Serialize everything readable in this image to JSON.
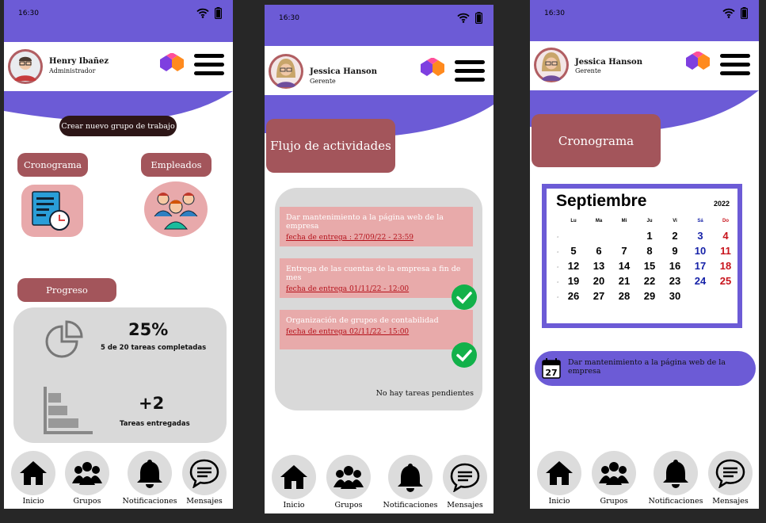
{
  "status": {
    "time": "16:30"
  },
  "screens": {
    "s1": {
      "user": {
        "name": "Henry Ibañez",
        "role": "Administrador"
      },
      "create_button": "Crear nuevo grupo de trabajo",
      "cronograma_label": "Cronograma",
      "empleados_label": "Empleados",
      "progreso_label": "Progreso",
      "progress_percent": "25%",
      "progress_text": "5 de 20 tareas completadas",
      "delivered": "+2",
      "delivered_text": "Tareas entregadas"
    },
    "s2": {
      "user": {
        "name": "Jessica Hanson",
        "role": "Gerente"
      },
      "title": "Flujo de actividades",
      "tasks": [
        {
          "title": "Dar mantenimiento a la página web de la empresa",
          "due": "fecha de entrega : 27/09/22 - 23:59",
          "done": false
        },
        {
          "title": "Entrega de las cuentas de la empresa a fin de mes",
          "due": "fecha de entrega 01/11/22 - 12:00",
          "done": true
        },
        {
          "title": "Organización de grupos de contabilidad",
          "due": "fecha de entrega 02/11/22 - 15:00",
          "done": true
        }
      ],
      "no_pending": "No hay tareas pendientes"
    },
    "s3": {
      "user": {
        "name": "Jessica Hanson",
        "role": "Gerente"
      },
      "title": "Cronograma",
      "calendar": {
        "month": "Septiembre",
        "year": "2022",
        "weekdays": [
          "Lu",
          "Ma",
          "Mi",
          "Ju",
          "Vi",
          "Sá",
          "Do"
        ],
        "weeks": [
          [
            "",
            "",
            "",
            "1",
            "2",
            "3",
            "4"
          ],
          [
            "5",
            "6",
            "7",
            "8",
            "9",
            "10",
            "11"
          ],
          [
            "12",
            "13",
            "14",
            "15",
            "16",
            "17",
            "18"
          ],
          [
            "19",
            "20",
            "21",
            "22",
            "23",
            "24",
            "25"
          ],
          [
            "26",
            "27",
            "28",
            "29",
            "30",
            "",
            ""
          ]
        ]
      },
      "event_day": "27",
      "event_text": "Dar mantenimiento a la página web de la empresa"
    }
  },
  "nav": [
    "Inicio",
    "Grupos",
    "Notificaciones",
    "Mensajes"
  ],
  "colors": {
    "purple": "#6c5bd6",
    "rose": "#a3555b",
    "task_bg": "#e8aaaa",
    "panel": "#d9d9d9",
    "green": "#12b14a",
    "sat": "#1622a8",
    "sun": "#c8141c"
  }
}
